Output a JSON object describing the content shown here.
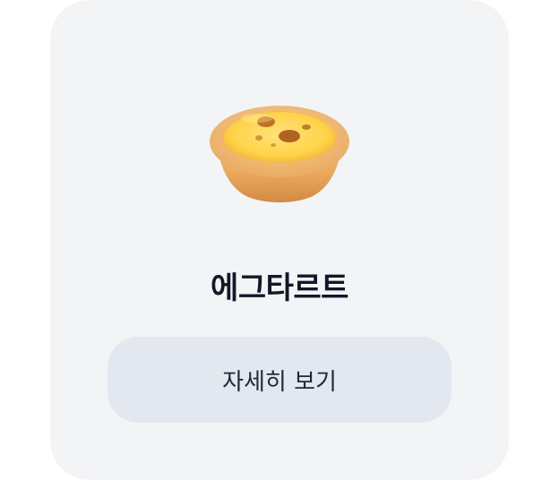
{
  "item": {
    "image_icon": "egg-tart-icon",
    "name": "에그타르트"
  },
  "actions": {
    "details_label": "자세히 보기"
  }
}
